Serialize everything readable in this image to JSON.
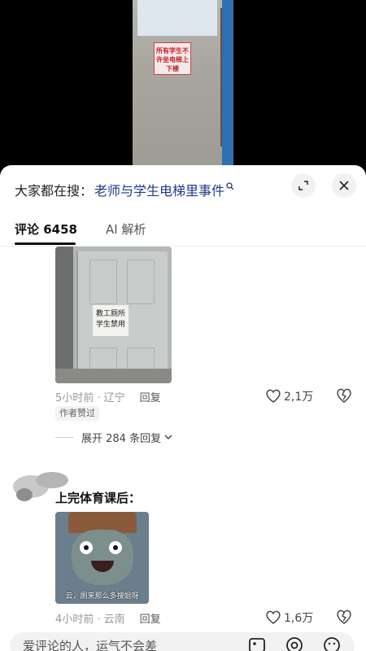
{
  "video": {
    "sign_text": "所有学生不许坐电梯上下楼"
  },
  "header": {
    "search_prefix": "大家都在搜：",
    "search_keyword": "老师与学生电梯里事件",
    "expand_icon": "expand-icon",
    "close_icon": "close-icon"
  },
  "tabs": [
    {
      "label": "评论 6458",
      "active": true
    },
    {
      "label": "AI 解析",
      "active": false
    }
  ],
  "comment1": {
    "image_sign": "教工厕所学生禁用",
    "meta": "5小时前 · 辽宁",
    "reply_label": "回复",
    "likes": "2,1万",
    "author_liked": "作者赞过",
    "expand_replies": "展开 284 条回复"
  },
  "comment2": {
    "username": "上完体育课后：",
    "image_caption": "云，厕来那么多搜姐呀",
    "meta": "4小时前 · 云南",
    "reply_label": "回复",
    "likes": "1,6万"
  },
  "input": {
    "placeholder": "爱评论的人，运气不会差"
  },
  "colors": {
    "keyword": "#1f3a8a",
    "sheet_bg": "#ffffff",
    "meta_gray": "#999999"
  }
}
